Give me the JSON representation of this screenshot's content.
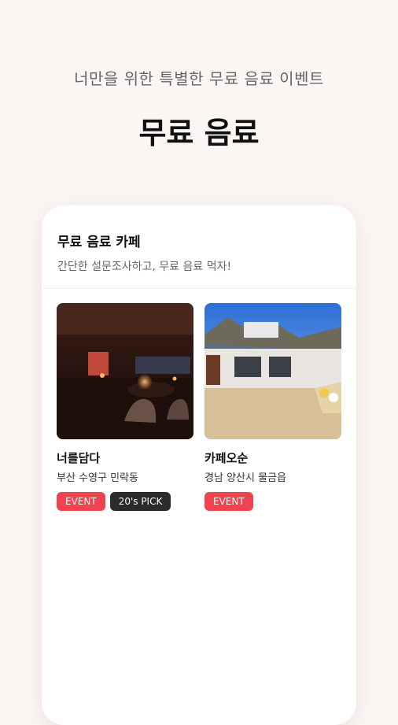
{
  "header": {
    "subtitle": "너만을 위한 특별한 무료 음료 이벤트",
    "title": "무료 음료"
  },
  "card": {
    "title": "무료 음료 카페",
    "description": "간단한 설문조사하고, 무료 음료 먹자!"
  },
  "cafes": [
    {
      "name": "너를담다",
      "location": "부산 수영구 민락동",
      "tags": [
        "EVENT",
        "20's PICK"
      ],
      "image": "dark cafe interior photo"
    },
    {
      "name": "카페오순",
      "location": "경남 양산시 물금읍",
      "tags": [
        "EVENT"
      ],
      "image": "cafe exterior photo"
    }
  ],
  "colors": {
    "background": "#fbf5f4",
    "event_tag": "#ef4350",
    "pick_tag": "#2b2b2b"
  }
}
